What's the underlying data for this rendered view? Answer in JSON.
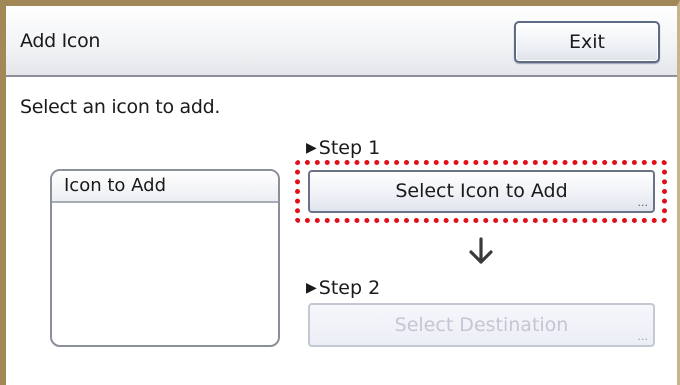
{
  "header": {
    "title": "Add Icon",
    "exit_label": "Exit"
  },
  "instruction": "Select an icon to add.",
  "icon_list": {
    "header": "Icon to Add",
    "items": []
  },
  "step1": {
    "arrow_icon": "triangle-right-icon",
    "label": "Step 1",
    "button_label": "Select Icon to Add",
    "ellipsis": "..."
  },
  "step2": {
    "arrow_icon": "triangle-right-icon",
    "label": "Step 2",
    "button_label": "Select Destination",
    "ellipsis": "...",
    "disabled": true
  },
  "flow_arrow_icon": "arrow-down-icon",
  "colors": {
    "frame_border": "#a28857",
    "highlight": "#e0101a",
    "disabled_text": "#c3c6d3"
  }
}
